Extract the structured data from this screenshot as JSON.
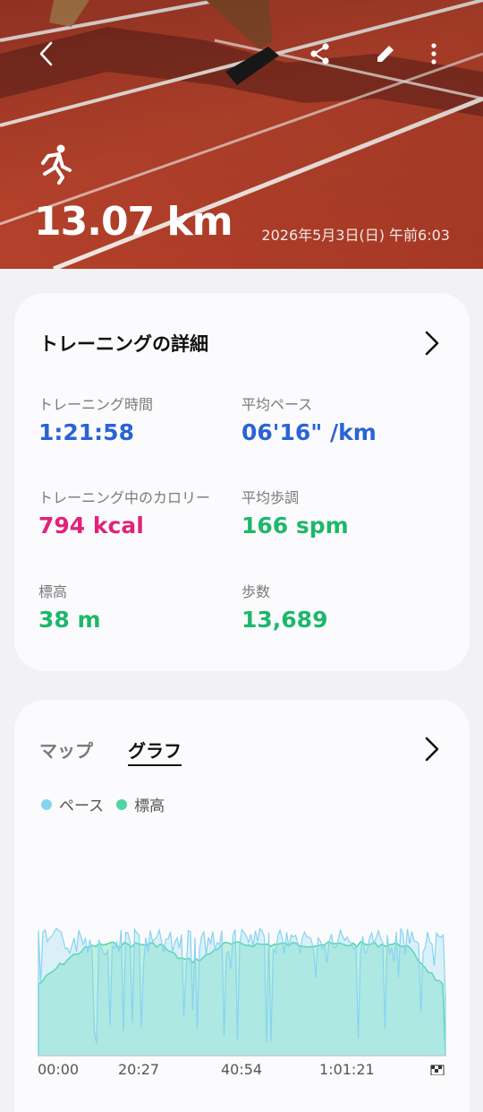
{
  "header": {
    "distance": "13.07 km",
    "datetime": "2026年5月3日(日) 午前6:03"
  },
  "icons": {
    "back": "back-arrow-icon",
    "share": "share-icon",
    "edit": "pencil-icon",
    "more": "more-vertical-icon",
    "activity": "running-icon",
    "chevron": "chevron-right-icon"
  },
  "details": {
    "title": "トレーニングの詳細",
    "metrics": [
      {
        "label": "トレーニング時間",
        "value": "1:21:58",
        "color": "#2a63d6"
      },
      {
        "label": "平均ペース",
        "value": "06'16\" /km",
        "color": "#2a63d6"
      },
      {
        "label": "トレーニング中のカロリー",
        "value": "794 kcal",
        "color": "#e0237a"
      },
      {
        "label": "平均歩調",
        "value": "166 spm",
        "color": "#1db86a"
      },
      {
        "label": "標高",
        "value": "38 m",
        "color": "#1db86a"
      },
      {
        "label": "歩数",
        "value": "13,689",
        "color": "#1db86a"
      }
    ]
  },
  "graph_card": {
    "tabs": [
      "マップ",
      "グラフ"
    ],
    "selected_tab": "グラフ",
    "legend": [
      {
        "name": "ペース",
        "color": "#86d3f2"
      },
      {
        "name": "標高",
        "color": "#4fd6a0"
      }
    ],
    "x_ticks": [
      "00:00",
      "20:27",
      "40:54",
      "1:01:21"
    ]
  },
  "chart_data": {
    "type": "area",
    "x_ticks": [
      "00:00",
      "20:27",
      "40:54",
      "1:01:21"
    ],
    "series": [
      {
        "name": "ペース",
        "color": "#86d3f2"
      },
      {
        "name": "標高",
        "color": "#4fd6a0"
      }
    ]
  }
}
